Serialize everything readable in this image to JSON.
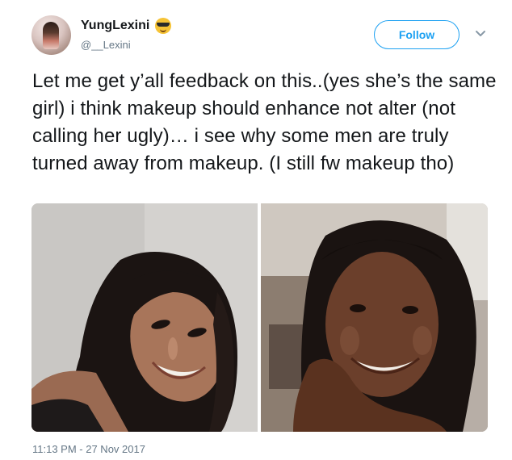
{
  "user": {
    "display_name": "YungLexini",
    "handle": "@__Lexini",
    "emoji_icon": "smiling-face-with-sunglasses-icon",
    "avatar_icon": "profile-avatar"
  },
  "follow_button": {
    "label": "Follow",
    "color": "#1da1f2"
  },
  "menu": {
    "icon": "chevron-down-icon"
  },
  "tweet": {
    "text": "Let me get y’all feedback on this..(yes she’s the same girl) i think makeup should enhance not alter (not calling her ugly)… i see why some men are truly turned away from makeup. (I still fw makeup tho)",
    "timestamp": "11:13 PM - 27 Nov 2017"
  },
  "media": {
    "photos": [
      {
        "subject": "woman-with-makeup-photo"
      },
      {
        "subject": "woman-without-makeup-photo"
      }
    ]
  },
  "colors": {
    "text": "#14171a",
    "secondary": "#657786",
    "accent": "#1da1f2"
  }
}
